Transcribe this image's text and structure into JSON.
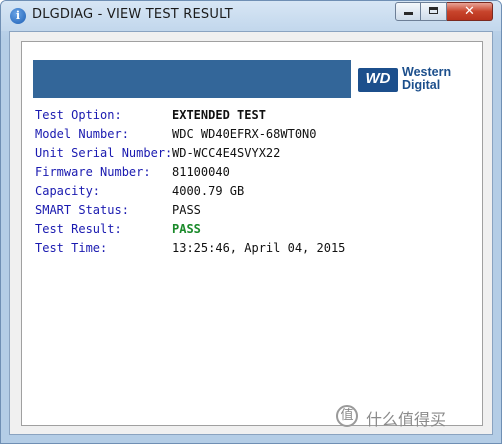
{
  "window": {
    "title": "DLGDIAG - VIEW TEST RESULT"
  },
  "controls": {
    "minimize": "minimize",
    "maximize": "maximize",
    "close": "✕"
  },
  "brand": {
    "mark": "WD",
    "line1": "Western",
    "line2": "Digital",
    "color": "#1c4f8c"
  },
  "header": {
    "color": "#336699"
  },
  "result": [
    {
      "label": "Test Option:",
      "value": "EXTENDED TEST",
      "style": "bold"
    },
    {
      "label": "Model Number:",
      "value": "WDC WD40EFRX-68WT0N0",
      "style": "normal"
    },
    {
      "label": "Unit Serial Number:",
      "value": "WD-WCC4E4SVYX22",
      "style": "normal"
    },
    {
      "label": "Firmware Number:",
      "value": "81100040",
      "style": "normal"
    },
    {
      "label": "Capacity:",
      "value": "4000.79 GB",
      "style": "normal"
    },
    {
      "label": "SMART Status:",
      "value": "PASS",
      "style": "normal"
    },
    {
      "label": "Test Result:",
      "value": "PASS",
      "style": "pass"
    },
    {
      "label": "Test Time:",
      "value": "13:25:46, April 04, 2015",
      "style": "normal"
    }
  ],
  "watermark": {
    "icon": "值",
    "text": "什么值得买"
  }
}
